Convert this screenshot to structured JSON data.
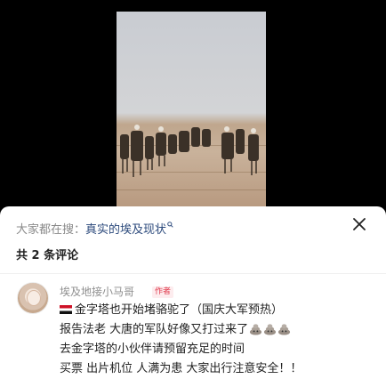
{
  "search": {
    "prefix": "大家都在搜：",
    "query": "真实的埃及现状"
  },
  "comments_header": {
    "count_label": "共 2 条评论"
  },
  "comment": {
    "username": "埃及地接小马哥",
    "badge": "作者",
    "lines": [
      "金字塔也开始堵骆驼了（国庆大军预热）",
      "报告法老 大唐的军队好像又打过来了",
      "去金字塔的小伙伴请预留充足的时间",
      "买票 出片机位 人满为患 大家出行注意安全！！"
    ],
    "line1_prefix_icon": "egypt-flag-icon",
    "line2_suffix_icons": [
      "poop-emoji-icon",
      "poop-emoji-icon",
      "poop-emoji-icon"
    ]
  }
}
